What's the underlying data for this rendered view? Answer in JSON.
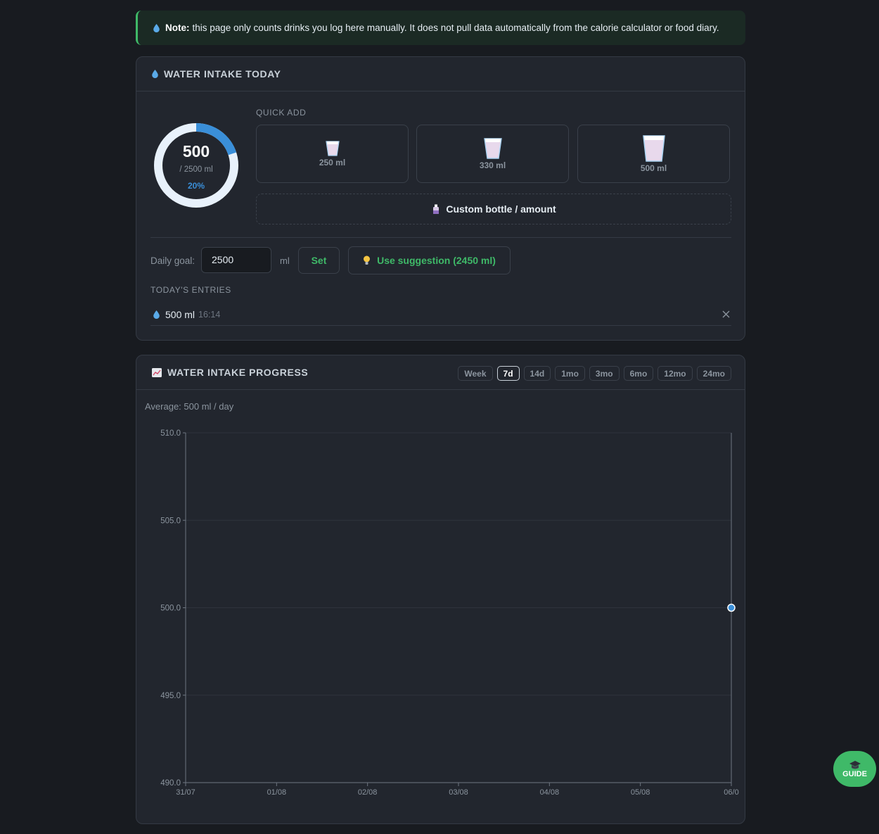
{
  "note": {
    "bold": "Note:",
    "text": "this page only counts drinks you log here manually. It does not pull data automatically from the calorie calculator or food diary."
  },
  "intake": {
    "title": "WATER INTAKE TODAY",
    "current": "500",
    "goal_text": "/ 2500 ml",
    "percent_text": "20%",
    "progress_fraction": 0.2,
    "quick_add_label": "QUICK ADD",
    "quick_add": [
      {
        "label": "250 ml",
        "icon": "glass-small-icon"
      },
      {
        "label": "330 ml",
        "icon": "glass-medium-icon"
      },
      {
        "label": "500 ml",
        "icon": "glass-large-icon"
      }
    ],
    "custom_label": "Custom bottle / amount",
    "goal_label": "Daily goal:",
    "goal_value": "2500",
    "goal_unit": "ml",
    "set_label": "Set",
    "suggestion_label": "Use suggestion (2450 ml)",
    "entries_label": "TODAY'S ENTRIES",
    "entries": [
      {
        "amount": "500 ml",
        "time": "16:14"
      }
    ]
  },
  "progress": {
    "title": "WATER INTAKE PROGRESS",
    "ranges": [
      "Week",
      "7d",
      "14d",
      "1mo",
      "3mo",
      "6mo",
      "12mo",
      "24mo"
    ],
    "active_range": "7d",
    "average_text": "Average: 500 ml / day"
  },
  "chart_data": {
    "type": "line",
    "x": [
      "31/07",
      "01/08",
      "02/08",
      "03/08",
      "04/08",
      "05/08",
      "06/0"
    ],
    "y_ticks": [
      "510.0",
      "505.0",
      "500.0",
      "495.0",
      "490.0"
    ],
    "ylim": [
      490,
      510
    ],
    "series": [
      {
        "values": [
          null,
          null,
          null,
          null,
          null,
          null,
          500
        ]
      }
    ],
    "grid": true
  },
  "guide": {
    "label": "GUIDE"
  },
  "colors": {
    "accent_green": "#3fb968",
    "accent_blue": "#3a8fd9",
    "ring_track": "#e8f1fb"
  }
}
